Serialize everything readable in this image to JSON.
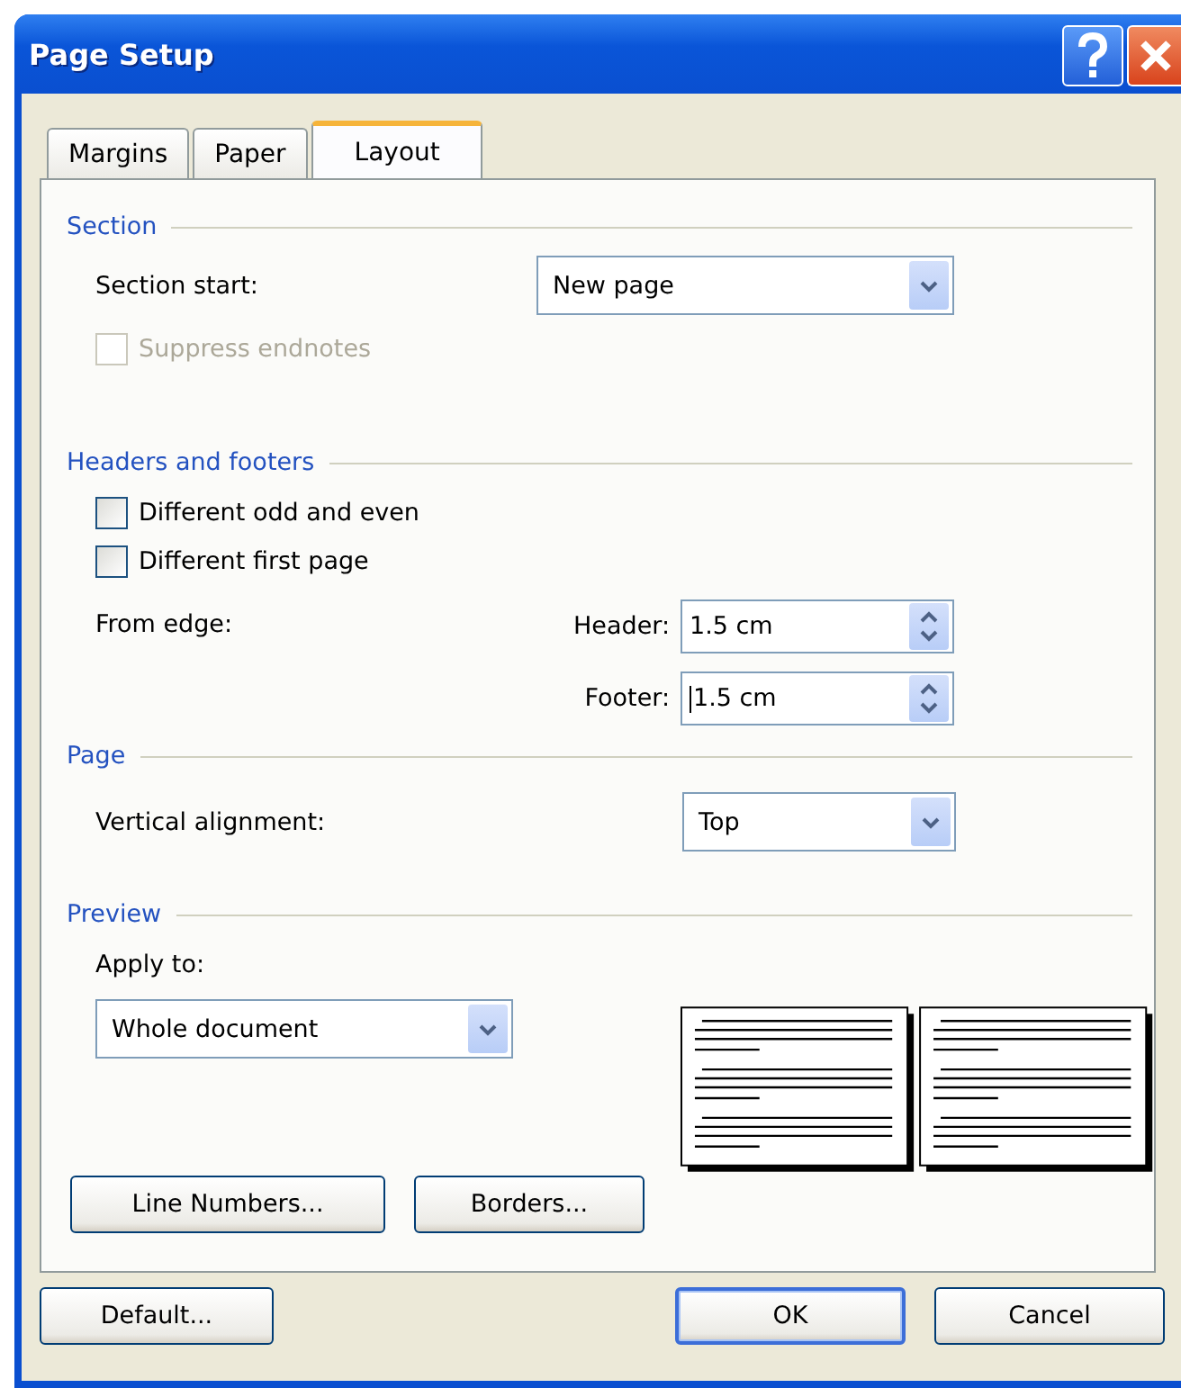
{
  "window": {
    "title": "Page Setup"
  },
  "tabs": [
    {
      "label": "Margins",
      "selected": false
    },
    {
      "label": "Paper",
      "selected": false
    },
    {
      "label": "Layout",
      "selected": true
    }
  ],
  "section": {
    "heading": "Section",
    "section_start": {
      "label": "Section start:",
      "value": "New page"
    },
    "suppress_endnotes": {
      "label": "Suppress endnotes",
      "checked": false,
      "disabled": true
    }
  },
  "headers_and_footers": {
    "heading": "Headers and footers",
    "checkboxes": [
      {
        "label": "Different odd and even",
        "checked": false,
        "disabled": false
      },
      {
        "label": "Different first page",
        "checked": false,
        "disabled": false
      }
    ],
    "from_edge": {
      "label": "From edge:"
    },
    "fields": [
      {
        "label": "Header:",
        "value": "1.5 cm",
        "caret": false
      },
      {
        "label": "Footer:",
        "value": "1.5 cm",
        "caret": true
      }
    ]
  },
  "page": {
    "heading": "Page",
    "vertical_alignment": {
      "label": "Vertical alignment:",
      "value": "Top"
    }
  },
  "preview": {
    "heading": "Preview",
    "apply_to": {
      "label": "Apply to:",
      "value": "Whole document"
    },
    "buttons": [
      {
        "label": "Line Numbers..."
      },
      {
        "label": "Borders..."
      }
    ]
  },
  "footer_buttons": [
    {
      "label": "Default...",
      "default": false
    },
    {
      "label": "OK",
      "default": true
    },
    {
      "label": "Cancel",
      "default": false
    }
  ]
}
